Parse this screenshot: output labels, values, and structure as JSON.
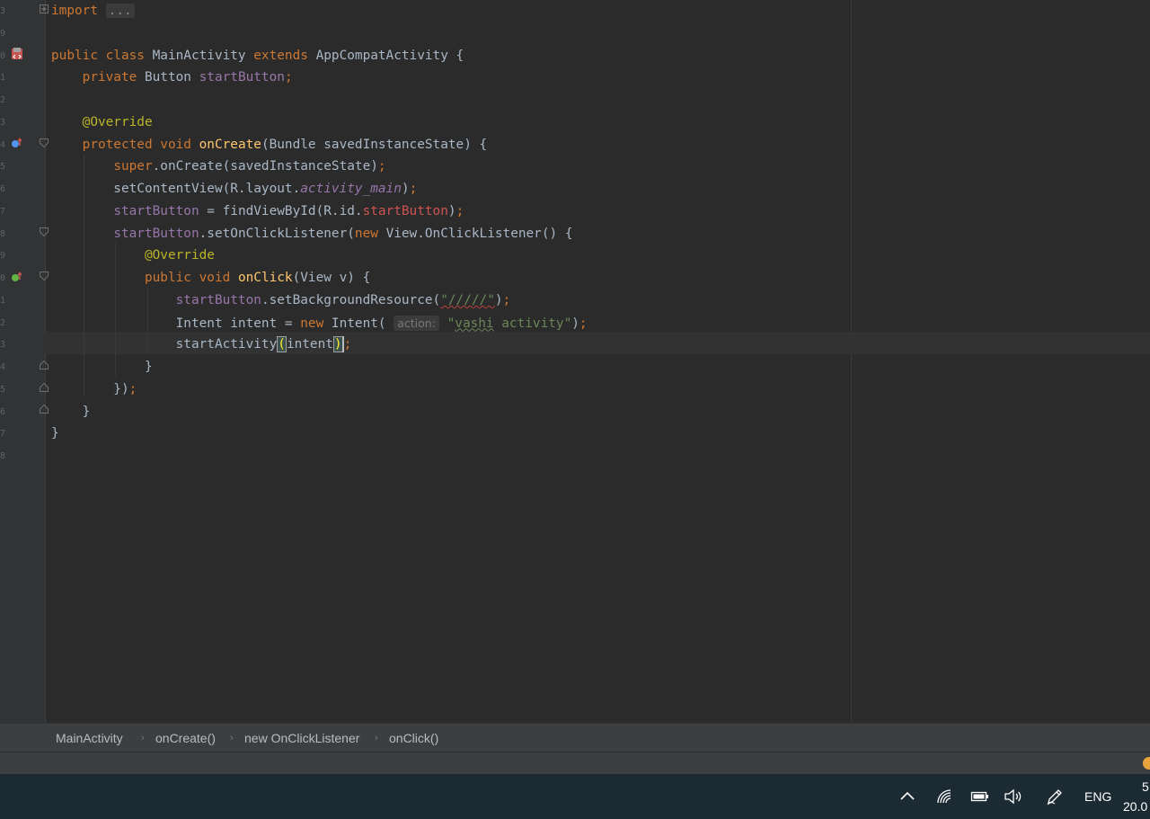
{
  "editor": {
    "lines": [
      {
        "num": "3",
        "html": "<span class=\"kw\">import</span> <span class=\"fold\">...</span>"
      },
      {
        "num": "9",
        "html": ""
      },
      {
        "num": "0",
        "html": "<span class=\"kw\">public class</span> MainActivity <span class=\"kw\">extends</span> AppCompatActivity {"
      },
      {
        "num": "1",
        "html": "    <span class=\"kw\">private</span> Button <span class=\"fld\">startButton</span><span class=\"kw\">;</span>"
      },
      {
        "num": "2",
        "html": ""
      },
      {
        "num": "3",
        "html": "    <span class=\"ann\">@Override</span>"
      },
      {
        "num": "4",
        "html": "    <span class=\"kw\">protected void</span> <span class=\"mth\">onCreate</span>(Bundle savedInstanceState) {"
      },
      {
        "num": "5",
        "html": "        <span class=\"kw\">super</span>.onCreate(savedInstanceState)<span class=\"kw\">;</span>"
      },
      {
        "num": "6",
        "html": "        setContentView(R.layout.<span class=\"ital\">activity_main</span>)<span class=\"kw\">;</span>"
      },
      {
        "num": "7",
        "html": "        <span class=\"fld\">startButton</span> = findViewById(R.id.<span class=\"res\">startButton</span>)<span class=\"kw\">;</span>"
      },
      {
        "num": "8",
        "html": "        <span class=\"fld\">startButton</span>.setOnClickListener(<span class=\"kw\">new</span> View.OnClickListener() {"
      },
      {
        "num": "9",
        "html": "            <span class=\"ann\">@Override</span>"
      },
      {
        "num": "0",
        "html": "            <span class=\"kw\">public void</span> <span class=\"mth\">onClick</span>(View v) {"
      },
      {
        "num": "1",
        "html": "                <span class=\"fld\">startButton</span>.setBackgroundResource(<span class=\"str squig\">\"/////\"</span>)<span class=\"kw\">;</span>"
      },
      {
        "num": "2",
        "html": "                Intent intent = <span class=\"kw\">new</span> Intent( <span class=\"hint\">action:</span> <span class=\"str\">\"<span class=\"squig-g\">vashi</span> activity\"</span>)<span class=\"kw\">;</span>"
      },
      {
        "num": "3",
        "html": "                startActivity<span class=\"brk\">(</span>intent<span class=\"brk\">)</span><span class=\"caret\"></span><span class=\"kw\">;</span>"
      },
      {
        "num": "4",
        "html": "            }"
      },
      {
        "num": "5",
        "html": "        })<span class=\"kw\">;</span>"
      },
      {
        "num": "6",
        "html": "    }"
      },
      {
        "num": "7",
        "html": "}"
      },
      {
        "num": "8",
        "html": ""
      }
    ]
  },
  "breadcrumb": {
    "items": [
      "MainActivity",
      "onCreate()",
      "new OnClickListener",
      "onClick()"
    ]
  },
  "taskbar": {
    "language": "ENG",
    "time": "5",
    "date": "20.0"
  },
  "icons": {
    "gutter_class": "android-class-icon",
    "gutter_override": "override-method-icon",
    "tray_chevron": "chevron-up-icon",
    "tray_wifi": "wifi-icon",
    "tray_battery": "battery-icon",
    "tray_volume": "volume-icon",
    "tray_pen": "pen-icon"
  }
}
